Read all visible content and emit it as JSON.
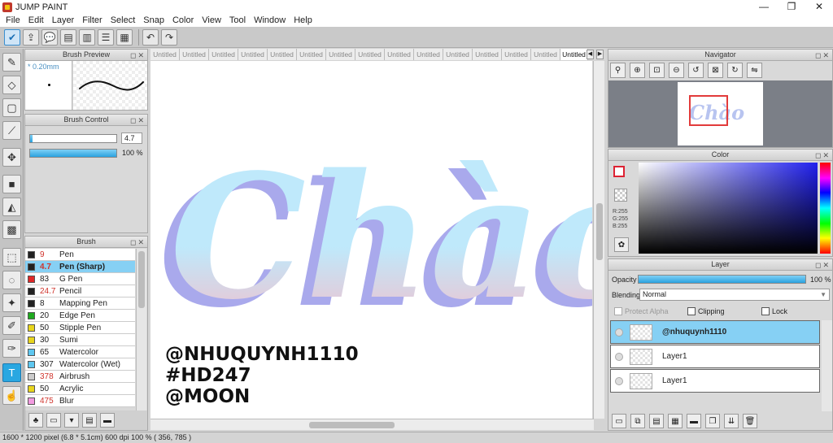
{
  "window": {
    "title": "JUMP PAINT",
    "minimize": "—",
    "maximize": "❐",
    "close": "✕"
  },
  "menu": [
    "File",
    "Edit",
    "Layer",
    "Filter",
    "Select",
    "Snap",
    "Color",
    "View",
    "Tool",
    "Window",
    "Help"
  ],
  "panels": {
    "brush_preview": {
      "title": "Brush Preview",
      "size": "* 0.20mm"
    },
    "brush_control": {
      "title": "Brush Control",
      "size_value": "4.7",
      "opacity_value": "100 %",
      "size_fraction": 0.03,
      "opacity_fraction": 1.0
    },
    "brush": {
      "title": "Brush",
      "items": [
        {
          "size": "9",
          "name": "Pen",
          "color": "#222222",
          "red": true
        },
        {
          "size": "4.7",
          "name": "Pen (Sharp)",
          "color": "#222222",
          "red": true,
          "selected": true
        },
        {
          "size": "83",
          "name": "G Pen",
          "color": "#e02828",
          "red": false
        },
        {
          "size": "24.7",
          "name": "Pencil",
          "color": "#222222",
          "red": true
        },
        {
          "size": "8",
          "name": "Mapping Pen",
          "color": "#222222",
          "red": false
        },
        {
          "size": "20",
          "name": "Edge Pen",
          "color": "#1faa1f",
          "red": false
        },
        {
          "size": "50",
          "name": "Stipple Pen",
          "color": "#e8d51c",
          "red": false
        },
        {
          "size": "30",
          "name": "Sumi",
          "color": "#e8d51c",
          "red": false
        },
        {
          "size": "65",
          "name": "Watercolor",
          "color": "#5ec7f0",
          "red": false
        },
        {
          "size": "307",
          "name": "Watercolor (Wet)",
          "color": "#5ec7f0",
          "red": false
        },
        {
          "size": "378",
          "name": "Airbrush",
          "color": "#cccccc",
          "red": true
        },
        {
          "size": "50",
          "name": "Acrylic",
          "color": "#e8d51c",
          "red": false
        },
        {
          "size": "475",
          "name": "Blur",
          "color": "#f29be0",
          "red": true
        }
      ]
    },
    "navigator": {
      "title": "Navigator"
    },
    "color": {
      "title": "Color",
      "r": "R:255",
      "g": "G:255",
      "b": "B:255"
    },
    "layer": {
      "title": "Layer",
      "opacity_label": "Opacity",
      "opacity_value": "100 %",
      "blending_label": "Blending",
      "blending_value": "Normal",
      "protect_alpha": "Protect Alpha",
      "clipping": "Clipping",
      "lock": "Lock",
      "layers": [
        {
          "name": "@nhuquynh1110",
          "selected": true
        },
        {
          "name": "Layer1",
          "selected": false
        },
        {
          "name": "Layer1",
          "selected": false
        }
      ]
    }
  },
  "tabs": [
    "Untitled",
    "Untitled",
    "Untitled",
    "Untitled",
    "Untitled",
    "Untitled",
    "Untitled",
    "Untitled",
    "Untitled",
    "Untitled",
    "Untitled",
    "Untitled",
    "Untitled",
    "Untitled",
    "Untitled"
  ],
  "canvas": {
    "lettering": "Chào",
    "credit_lines": [
      "@NHUQUYNH1110",
      "#HD247",
      "@MOON"
    ],
    "lettering_colors": {
      "top": "#bfe9fb",
      "bottom": "#f8b9c6",
      "shadow": "#a9a9ec"
    }
  },
  "status": "1600 * 1200 pixel   (6.8 * 5.1cm)   600 dpi   100 %   ( 356, 785 )"
}
